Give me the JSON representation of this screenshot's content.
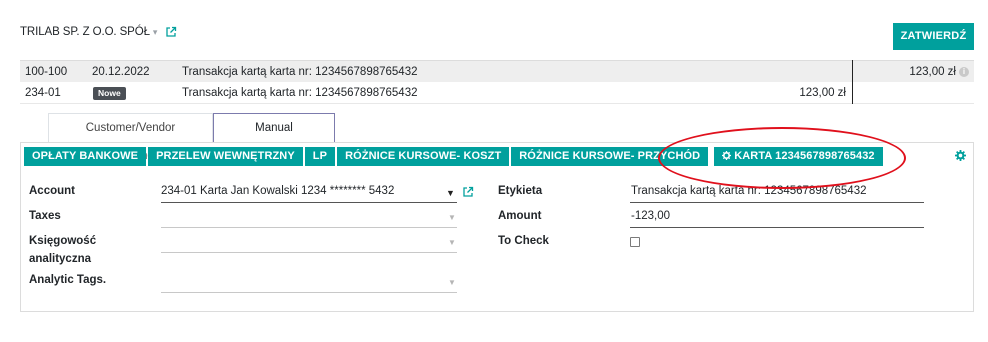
{
  "header": {
    "partner_name": "TRILAB SP. Z O.O. SPÓŁ",
    "confirm_label": "ZATWIERDŹ"
  },
  "lines": [
    {
      "account": "100-100",
      "date": "20.12.2022",
      "label": "Transakcja kartą karta nr: 1234567898765432",
      "debit": "",
      "credit": "123,00 zł"
    },
    {
      "account": "234-01",
      "badge": "Nowe",
      "label": "Transakcja kartą karta nr: 1234567898765432",
      "debit": "123,00 zł",
      "credit": ""
    }
  ],
  "tabs": [
    {
      "label": "Customer/Vendor Matching",
      "active": false
    },
    {
      "label": "Manual Operations",
      "active": true
    }
  ],
  "operation_buttons": [
    "OPŁATY BANKOWE",
    "PRZELEW WEWNĘTRZNY",
    "LP",
    "RÓŻNICE KURSOWE- KOSZT",
    "RÓŻNICE KURSOWE- PRZYCHÓD",
    "KARTA 1234567898765432"
  ],
  "form_left": {
    "account_label": "Account",
    "account_value": "234-01 Karta Jan Kowalski 1234 ******** 5432",
    "taxes_label": "Taxes",
    "analytic_account_label_1": "Księgowość",
    "analytic_account_label_2": "analityczna",
    "analytic_tags_label": "Analytic Tags."
  },
  "form_right": {
    "label_label": "Etykieta",
    "label_value": "Transakcja kartą karta nr: 1234567898765432",
    "amount_label": "Amount",
    "amount_value": "-123,00",
    "to_check_label": "To Check",
    "to_check_checked": false
  },
  "colors": {
    "primary": "#00A09D",
    "highlight_ellipse": "#e0101c",
    "active_tab_border": "#7C7BAD",
    "badge": "#4a4f55"
  },
  "icons": {
    "external_link": "external-link-icon",
    "gear": "gear-icon",
    "info": "info-icon",
    "caret": "caret-down-icon"
  }
}
